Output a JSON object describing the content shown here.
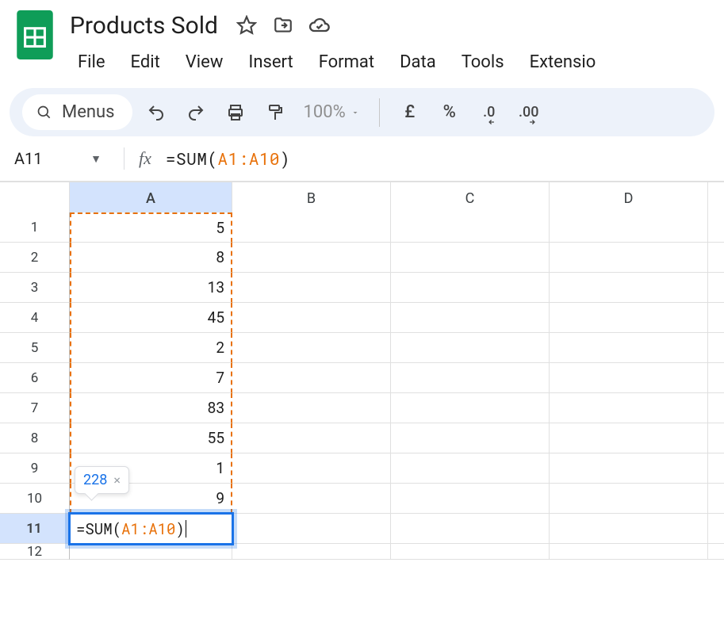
{
  "doc": {
    "title": "Products Sold"
  },
  "menubar": {
    "file": "File",
    "edit": "Edit",
    "view": "View",
    "insert": "Insert",
    "format": "Format",
    "data": "Data",
    "tools": "Tools",
    "extensions": "Extensio"
  },
  "toolbar": {
    "menus_label": "Menus",
    "zoom": "100%",
    "currency_symbol": "£",
    "percent_symbol": "%",
    "dec_less": ".0",
    "dec_more": ".00"
  },
  "namebox": {
    "value": "A11"
  },
  "formula": {
    "prefix": "=SUM(",
    "ref": "A1:A10",
    "suffix": ")"
  },
  "columns": {
    "a": "A",
    "b": "B",
    "c": "C",
    "d": "D"
  },
  "rows": [
    "1",
    "2",
    "3",
    "4",
    "5",
    "6",
    "7",
    "8",
    "9",
    "10",
    "11",
    "12"
  ],
  "chart_data": {
    "type": "table",
    "active_cell": "A11",
    "selection_range": "A1:A10",
    "columns": [
      "A"
    ],
    "data": {
      "A": [
        5,
        8,
        13,
        45,
        2,
        7,
        83,
        55,
        1,
        9
      ]
    },
    "formula_cell": {
      "ref": "A11",
      "formula": "=SUM(A1:A10)",
      "preview_result": 228
    }
  },
  "tooltip": {
    "value": "228"
  }
}
